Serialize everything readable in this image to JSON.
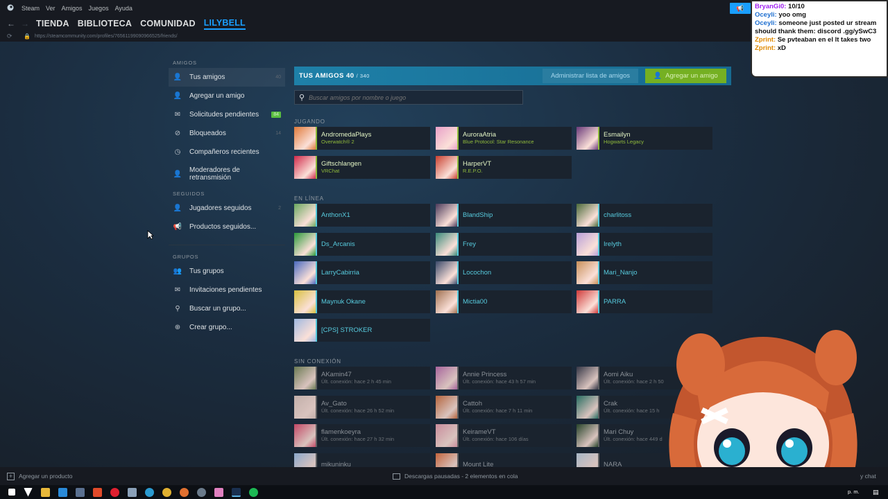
{
  "menu": [
    "Steam",
    "Ver",
    "Amigos",
    "Juegos",
    "Ayuda"
  ],
  "nav": {
    "links": [
      "TIENDA",
      "BIBLIOTECA",
      "COMUNIDAD",
      "LILYBELL"
    ],
    "active": "LILYBELL"
  },
  "url": "https://steamcommunity.com/profiles/76561199090966525/friends/",
  "sidebar": {
    "amigos_head": "AMIGOS",
    "amigos": [
      {
        "label": "Tus amigos",
        "count": "40",
        "icon": "person-icon",
        "active": true
      },
      {
        "label": "Agregar un amigo",
        "count": "",
        "icon": "person-plus-icon"
      },
      {
        "label": "Solicitudes pendientes",
        "count": "84",
        "icon": "envelope-icon"
      },
      {
        "label": "Bloqueados",
        "count": "14",
        "icon": "blocked-icon"
      },
      {
        "label": "Compañeros recientes",
        "count": "",
        "icon": "clock-icon"
      },
      {
        "label": "Moderadores de retransmisión",
        "count": "",
        "icon": "person-shield-icon"
      }
    ],
    "seguidos_head": "SEGUIDOS",
    "seguidos": [
      {
        "label": "Jugadores seguidos",
        "count": "2",
        "icon": "person-follow-icon"
      },
      {
        "label": "Productos seguidos...",
        "count": "",
        "icon": "megaphone-icon"
      }
    ],
    "grupos_head": "GRUPOS",
    "grupos": [
      {
        "label": "Tus grupos",
        "icon": "group-icon"
      },
      {
        "label": "Invitaciones pendientes",
        "icon": "envelope-icon"
      },
      {
        "label": "Buscar un grupo...",
        "icon": "search-icon"
      },
      {
        "label": "Crear grupo...",
        "icon": "plus-circle-icon"
      }
    ]
  },
  "friends": {
    "title": "TUS AMIGOS 40",
    "total": "/ 340",
    "manage": "Administrar lista de amigos",
    "add": "Agregar un amigo",
    "search_placeholder": "Buscar amigos por nombre o juego",
    "sec_playing": "JUGANDO",
    "sec_online": "EN LÍNEA",
    "sec_offline": "SIN CONEXIÓN",
    "playing": [
      {
        "name": "AndromedaPlays",
        "status": "Overwatch® 2",
        "color": "#e07a3a"
      },
      {
        "name": "AuroraAtria",
        "status": "Blue Protocol: Star Resonance",
        "color": "#e8a0c8"
      },
      {
        "name": "Esmailyn",
        "status": "Hogwarts Legacy",
        "color": "#6a3a7a"
      },
      {
        "name": "Giftschlangen",
        "status": "VRChat",
        "color": "#d02a4a"
      },
      {
        "name": "HarperVT",
        "status": "R.E.P.O.",
        "color": "#c84030"
      }
    ],
    "online": [
      {
        "name": "AnthonX1",
        "color": "#6aa860"
      },
      {
        "name": "BlandShip",
        "color": "#4a3a5a"
      },
      {
        "name": "charlitoss",
        "color": "#4a6a3a"
      },
      {
        "name": "Ds_Arcanis",
        "color": "#2a9a3a"
      },
      {
        "name": "Frey",
        "color": "#3a8a7a"
      },
      {
        "name": "Irelyth",
        "color": "#b8a0d8"
      },
      {
        "name": "LarryCabirria",
        "color": "#4a6ac0"
      },
      {
        "name": "Locochon",
        "color": "#3a4a6a"
      },
      {
        "name": "Mari_Nanjo",
        "color": "#c8905a"
      },
      {
        "name": "Maynuk Okane",
        "color": "#d8c040"
      },
      {
        "name": "Mictia00",
        "color": "#a07050"
      },
      {
        "name": "PARRA",
        "color": "#d03a3a"
      },
      {
        "name": "[CPS] STROKER",
        "color": "#a0b8e0"
      }
    ],
    "offline": [
      {
        "name": "AKamin47",
        "status": "Últ. conexión: hace 2 h 45 min",
        "color": "#7a8a5a"
      },
      {
        "name": "Annie Princess",
        "status": "Últ. conexión: hace 43 h 57 min",
        "color": "#c070b0"
      },
      {
        "name": "Aomi Aiku",
        "status": "Últ. conexión: hace 2 h 50",
        "color": "#3a3a4a"
      },
      {
        "name": "Av_Gato",
        "status": "Últ. conexión: hace 26 h 52 min",
        "color": "#e0c8c0"
      },
      {
        "name": "Cattoh",
        "status": "Últ. conexión: hace 7 h 11 min",
        "color": "#d07040"
      },
      {
        "name": "Crak",
        "status": "Últ. conexión: hace 15 h",
        "color": "#2a7a6a"
      },
      {
        "name": "flamenkoeyra",
        "status": "Últ. conexión: hace 27 h 32 min",
        "color": "#e05070"
      },
      {
        "name": "KeirameVT",
        "status": "Últ. conexión: hace 106 días",
        "color": "#e8a0b0"
      },
      {
        "name": "Mari Chuy",
        "status": "Últ. conexión: hace 449 d",
        "color": "#2a4a2a"
      },
      {
        "name": "mikuninku",
        "status": "",
        "color": "#a0c0e8"
      },
      {
        "name": "Mount Lite",
        "status": "",
        "color": "#e07040"
      },
      {
        "name": "NARA",
        "status": "",
        "color": "#c0d0e0"
      }
    ]
  },
  "chat": {
    "lines": [
      {
        "user": "BryanGi0:",
        "msg": "10/10",
        "ucolor": "#a020f0"
      },
      {
        "user": "Oceyli:",
        "msg": "yoo omg",
        "ucolor": "#1e6fd0"
      },
      {
        "user": "Oceyli:",
        "msg": "someone just posted ur stream",
        "ucolor": "#1e6fd0"
      },
      {
        "user": "",
        "msg": "should thank them: discord .gg/ySwC3",
        "ucolor": "#111111"
      },
      {
        "user": "Zprint:",
        "msg": "Se pvteaban en el lt takes two",
        "ucolor": "#e08a00"
      },
      {
        "user": "Zprint:",
        "msg": "xD",
        "ucolor": "#e08a00"
      }
    ]
  },
  "bottom": {
    "add_product": "Agregar un producto",
    "downloads": "Descargas pausadas - 2 elementos en cola",
    "chat": "y chat"
  },
  "taskbar": {
    "clock": "p. m."
  }
}
